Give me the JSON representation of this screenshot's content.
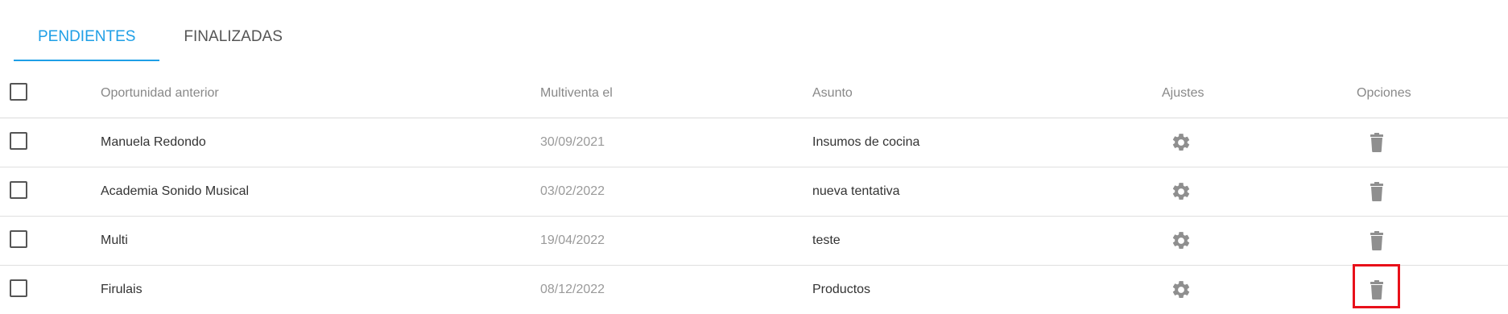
{
  "tabs": [
    {
      "label": "PENDIENTES",
      "active": true
    },
    {
      "label": "FINALIZADAS",
      "active": false
    }
  ],
  "table": {
    "headers": {
      "opportunity": "Oportunidad anterior",
      "date": "Multiventa el",
      "subject": "Asunto",
      "settings": "Ajustes",
      "options": "Opciones"
    },
    "rows": [
      {
        "opportunity": "Manuela Redondo",
        "date": "30/09/2021",
        "subject": "Insumos de cocina"
      },
      {
        "opportunity": "Academia Sonido Musical",
        "date": "03/02/2022",
        "subject": "nueva tentativa"
      },
      {
        "opportunity": "Multi",
        "date": "19/04/2022",
        "subject": "teste"
      },
      {
        "opportunity": "Firulais",
        "date": "08/12/2022",
        "subject": "Productos"
      }
    ]
  },
  "icons": {
    "settings": "gear-icon",
    "delete": "trash-icon"
  },
  "colors": {
    "accent": "#1e9fe6",
    "icon": "#8f8f8f",
    "highlight": "#e8101a"
  }
}
